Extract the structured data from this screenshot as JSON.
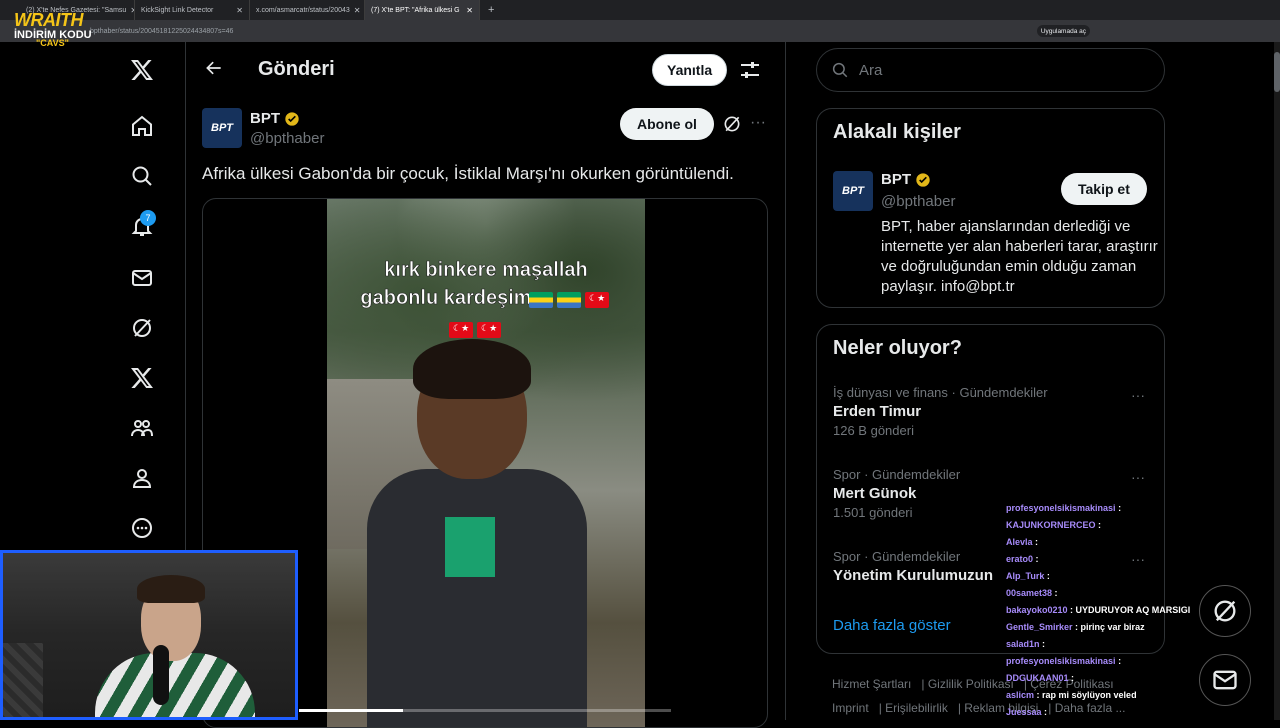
{
  "browser": {
    "tabs": [
      {
        "label": "(2) X'te Nefes Gazetesi: \"Samsu"
      },
      {
        "label": "KickSight Link Detector"
      },
      {
        "label": "x.com/asmarcatr/status/20043"
      },
      {
        "label": "(7) X'te BPT: \"Afrika ülkesi G"
      }
    ],
    "url": "bpthaber/status/20045181225024434807s=46",
    "app_button": "Uygulamada aç"
  },
  "overlay_brand": {
    "line1": "WRAITH",
    "line2": "İNDİRİM KODU",
    "line3": "\"CAVS\""
  },
  "nav": {
    "notification_count": "7"
  },
  "header": {
    "title": "Gönderi",
    "reply_label": "Yanıtla"
  },
  "post": {
    "avatar_text": "BPT",
    "name": "BPT",
    "handle": "@bpthaber",
    "subscribe_label": "Abone ol",
    "text": "Afrika ülkesi Gabon'da bir çocuk, İstiklal Marşı'nı okurken görüntülendi.",
    "video": {
      "caption_line1": "kırk binkere maşallah",
      "caption_line2": "gabonlu kardeşim",
      "progress": 0.28
    }
  },
  "search": {
    "placeholder": "Ara"
  },
  "related": {
    "title": "Alakalı kişiler",
    "avatar_text": "BPT",
    "name": "BPT",
    "handle": "@bpthaber",
    "follow_label": "Takip et",
    "bio": "BPT, haber ajanslarından derlediği ve internette yer alan haberleri tarar, araştırır ve doğruluğundan emin olduğu zaman paylaşır. info@bpt.tr"
  },
  "trends": {
    "title": "Neler oluyor?",
    "items": [
      {
        "category": "İş dünyası ve finans · Gündemdekiler",
        "name": "Erden Timur",
        "count": "126 B gönderi"
      },
      {
        "category": "Spor · Gündemdekiler",
        "name": "Mert Günok",
        "count": "1.501 gönderi"
      },
      {
        "category": "Spor · Gündemdekiler",
        "name": "Yönetim Kurulumuzun",
        "count": ""
      }
    ],
    "show_more": "Daha fazla göster"
  },
  "footer": {
    "links": [
      "Hizmet Şartları",
      "Gizlilik Politikası",
      "Çerez Politikası",
      "Imprint",
      "Erişilebilirlik",
      "Reklam bilgisi",
      "Daha fazla ..."
    ]
  },
  "chat": [
    {
      "user": "profesyonelsikismakinasi",
      "msg": ""
    },
    {
      "user": "KAJUNKORNERCEO",
      "msg": ""
    },
    {
      "user": "Alevla",
      "msg": ""
    },
    {
      "user": "erato0",
      "msg": ""
    },
    {
      "user": "Alp_Turk",
      "msg": ""
    },
    {
      "user": "00samet38",
      "msg": ""
    },
    {
      "user": "bakayoko0210",
      "msg": "UYDURUYOR AQ MARSIGI"
    },
    {
      "user": "Gentle_Smirker",
      "msg": "pirinç var biraz"
    },
    {
      "user": "salad1n",
      "msg": ""
    },
    {
      "user": "profesyonelsikismakinasi",
      "msg": ""
    },
    {
      "user": "DDGUKAAN01",
      "msg": ""
    },
    {
      "user": "aslicm",
      "msg": "rap mi söylüyon veled"
    },
    {
      "user": "Juessaa",
      "msg": ""
    }
  ],
  "colors": {
    "accent": "#1d9bf0",
    "background": "#000000",
    "border": "#2f3336",
    "muted": "#71767b"
  }
}
